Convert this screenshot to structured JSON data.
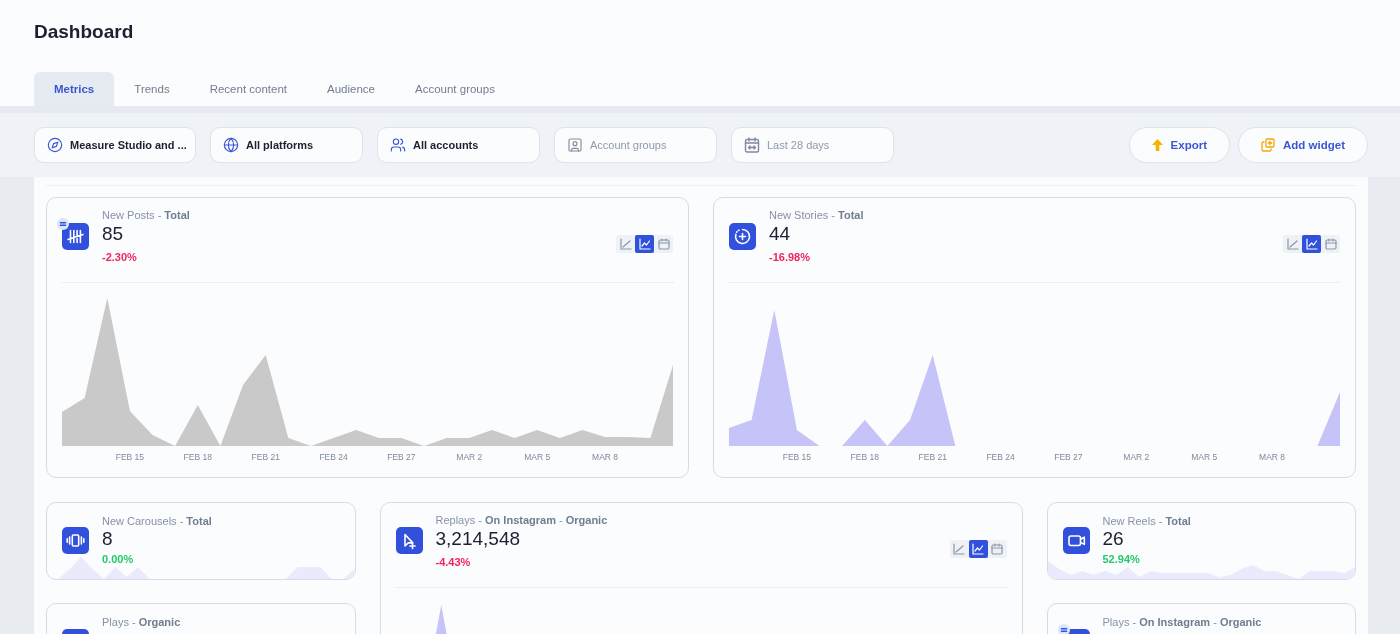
{
  "page": {
    "title": "Dashboard"
  },
  "tabs": [
    {
      "label": "Metrics",
      "selected": true
    },
    {
      "label": "Trends",
      "selected": false
    },
    {
      "label": "Recent content",
      "selected": false
    },
    {
      "label": "Audience",
      "selected": false
    },
    {
      "label": "Account groups",
      "selected": false
    }
  ],
  "filters": [
    {
      "value": "Measure Studio and ..."
    },
    {
      "value": "All platforms"
    },
    {
      "value": "All accounts"
    },
    {
      "placeholder": "Account groups"
    },
    {
      "placeholder": "Last 28 days"
    }
  ],
  "actions": [
    {
      "label": "Export"
    },
    {
      "label": "Add widget"
    }
  ],
  "widgets": [
    {
      "kind": "chart",
      "title": "New Posts - **Total**",
      "value": "85",
      "change": {
        "text": "-2.30%",
        "color": "#f0245e"
      },
      "list_badge": true,
      "color": "#c8c9c8",
      "chart_types": [
        {
          "kind": "line",
          "selected": false
        },
        {
          "kind": "area",
          "selected": true
        },
        {
          "kind": "calendar",
          "selected": false
        }
      ],
      "x_labels": [
        "FEB 15",
        "FEB 18",
        "FEB 21",
        "FEB 24",
        "FEB 27",
        "MAR 2",
        "MAR 5",
        "MAR 8"
      ]
    },
    {
      "kind": "chart",
      "title": "New Stories - **Total**",
      "value": "44",
      "change": {
        "text": "-16.98%",
        "color": "#f0245e"
      },
      "list_badge": false,
      "color": "#c5c3f7",
      "chart_types": [
        {
          "kind": "line",
          "selected": false
        },
        {
          "kind": "area",
          "selected": true
        },
        {
          "kind": "calendar",
          "selected": false
        }
      ],
      "x_labels": [
        "FEB 15",
        "FEB 18",
        "FEB 21",
        "FEB 24",
        "FEB 27",
        "MAR 2",
        "MAR 5",
        "MAR 8"
      ]
    },
    {
      "kind": "compact",
      "title": "New Carousels - **Total**",
      "value": "8",
      "change": {
        "text": "0.00%",
        "color": "#22c96a"
      },
      "list_badge": false
    },
    {
      "kind": "chart",
      "title": "Replays - **On Instagram** - **Organic**",
      "value": "3,214,548",
      "change": {
        "text": "-4.43%",
        "color": "#f0245e"
      },
      "list_badge": false,
      "color": "#c5c3f7",
      "chart_types": [
        {
          "kind": "line",
          "selected": false
        },
        {
          "kind": "area",
          "selected": true
        },
        {
          "kind": "calendar",
          "selected": false
        }
      ]
    },
    {
      "kind": "compact",
      "title": "New Reels - **Total**",
      "value": "26",
      "change": {
        "text": "52.94%",
        "color": "#22c96a"
      },
      "list_badge": false
    },
    {
      "kind": "compact",
      "title": "Plays - **Organic**",
      "list_badge": false
    },
    {
      "kind": "compact",
      "title": "Plays - **On Instagram** - **Organic**",
      "list_badge": true
    }
  ]
}
